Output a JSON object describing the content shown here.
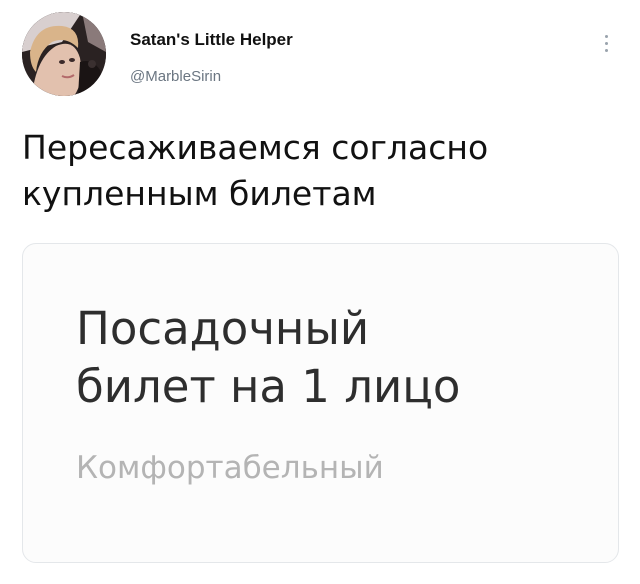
{
  "author": {
    "display_name": "Satan's Little Helper",
    "handle": "@MarbleSirin"
  },
  "icons": {
    "avatar": "profile-photo",
    "more": "vertical-ellipsis-icon"
  },
  "tweet": {
    "text_lines": [
      "Пересаживаемся согласно",
      "купленным билетам"
    ]
  },
  "media": {
    "ticket_title_lines": [
      "Посадочный",
      "билет на 1 лицо"
    ],
    "ticket_class": "Комфортабельный"
  },
  "colors": {
    "text": "#111111",
    "secondary": "#6b7682",
    "card_border": "#e4e7ea",
    "ticket_text": "#2e2e2e",
    "ticket_muted": "#b4b4b4"
  }
}
